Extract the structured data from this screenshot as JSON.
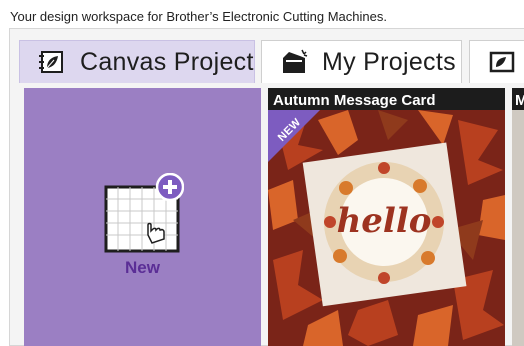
{
  "header": {
    "tagline": "Your design workspace for Brother’s Electronic Cutting Machines."
  },
  "tabs": [
    {
      "label": "Canvas Project",
      "icon": "canvas-project-icon",
      "active": true
    },
    {
      "label": "My Projects",
      "icon": "folder-icon",
      "active": false
    },
    {
      "label": "",
      "icon": "image-icon",
      "active": false
    }
  ],
  "tiles": {
    "new": {
      "label": "New",
      "icon": "add-canvas-icon"
    },
    "cards": [
      {
        "title": "Autumn Message Card",
        "badge": "NEW",
        "image_text": "hello"
      },
      {
        "title": "M"
      }
    ]
  },
  "colors": {
    "accent_purple": "#9b7fc3",
    "active_tab": "#ddd7ef",
    "new_label": "#5b2e96",
    "badge_purple": "#7d5cc0"
  }
}
